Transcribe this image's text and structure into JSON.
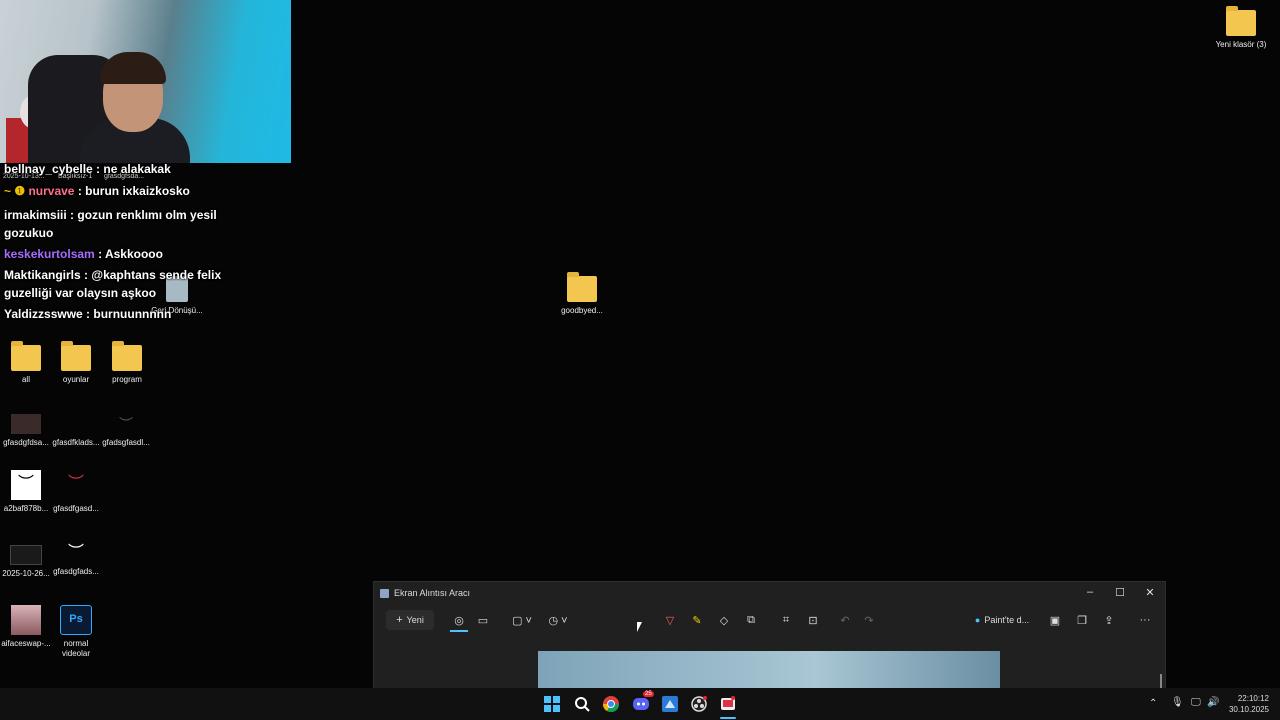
{
  "chat": [
    {
      "user": "bellnay_cybelle",
      "text": " : ne alakakak",
      "color": "#ffffff"
    },
    {
      "user": "nurvave",
      "text": " : burun ixkaizkosko",
      "color": "#ff6f8a",
      "badge": "~ ❶"
    },
    {
      "user": "irmakimsiii",
      "text": " : gozun renklımı olm yesil gozukuo",
      "color": "#ffffff"
    },
    {
      "user": "keskekurtolsam",
      "text": " : Askkoooo",
      "color": "#a86bff"
    },
    {
      "user": "Maktikangirls",
      "text": " : @kaphtans sende felix guzelliği var olaysın aşkoo",
      "color": "#ffffff"
    },
    {
      "user": "Yaldizzsswwe",
      "text": " : burnuunnnnn",
      "color": "#ffffff"
    }
  ],
  "desktop": {
    "row_labels": [
      "2025-10-13...",
      "Başlıksız-1",
      "gfasdgfsda..."
    ],
    "recycle_bin": "Geri Dönüşü...",
    "folders": [
      {
        "label": "all",
        "icon": "folder-icon"
      },
      {
        "label": "oyunlar",
        "icon": "folder-icon"
      },
      {
        "label": "program",
        "icon": "folder-icon"
      }
    ],
    "row3": [
      "gfasdgfdsa...",
      "gfasdfklads...",
      "gfadsgfasdl..."
    ],
    "row4": [
      "a2baf878b...",
      "gfasdfgasd..."
    ],
    "row5": [
      "2025-10-26...",
      "gfasdgfads..."
    ],
    "row6": [
      "aifaceswap-...",
      "normal videolar"
    ],
    "center_folder": "goodbyed...",
    "top_right_folder": "Yeni klasör (3)"
  },
  "snip": {
    "title": "Ekran Alıntısı Aracı",
    "new_label": "Yeni",
    "paint_label": "Paint'te d..."
  },
  "taskbar": {
    "time": "22:10:12",
    "date": "30.10.2025",
    "discord_badge": "25"
  },
  "colors": {
    "accent": "#4cc2ff",
    "chat_pink": "#ff6f8a",
    "chat_purple": "#a86bff"
  }
}
